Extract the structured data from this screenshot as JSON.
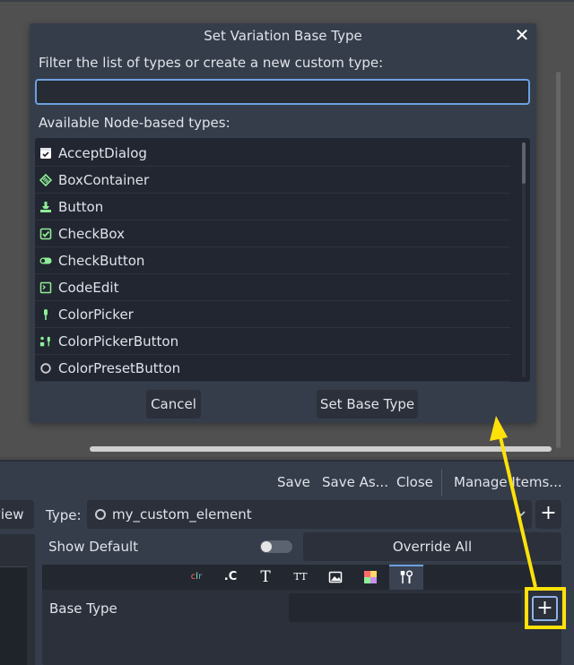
{
  "dialog": {
    "title": "Set Variation Base Type",
    "close_symbol": "✕",
    "filter_label": "Filter the list of types or create a new custom type:",
    "filter_value": "",
    "types_label": "Available Node-based types:",
    "types": [
      {
        "label": "AcceptDialog",
        "icon": "accept-dialog-icon",
        "color": "#ffffff"
      },
      {
        "label": "BoxContainer",
        "icon": "box-container-icon",
        "color": "#8eef97"
      },
      {
        "label": "Button",
        "icon": "button-icon",
        "color": "#8eef97"
      },
      {
        "label": "CheckBox",
        "icon": "checkbox-icon",
        "color": "#8eef97"
      },
      {
        "label": "CheckButton",
        "icon": "check-button-icon",
        "color": "#8eef97"
      },
      {
        "label": "CodeEdit",
        "icon": "code-edit-icon",
        "color": "#8eef97"
      },
      {
        "label": "ColorPicker",
        "icon": "color-picker-icon",
        "color": "#8eef97"
      },
      {
        "label": "ColorPickerButton",
        "icon": "color-picker-button-icon",
        "color": "#8eef97"
      },
      {
        "label": "ColorPresetButton",
        "icon": "color-preset-button-icon",
        "color": "#c9ccd2"
      }
    ],
    "cancel_label": "Cancel",
    "confirm_label": "Set Base Type"
  },
  "toolbar": {
    "save": "Save",
    "save_as": "Save As...",
    "close": "Close",
    "manage_items": "Manage Items..."
  },
  "editor": {
    "view_label": "view",
    "type_label": "Type:",
    "type_value": "my_custom_element",
    "add_symbol": "+",
    "show_default_label": "Show Default",
    "override_all_label": "Override All",
    "tabs": [
      {
        "name": "tab-colors",
        "icon": "colors-icon",
        "text": "clr"
      },
      {
        "name": "tab-constants",
        "icon": "constants-icon",
        "text": ".C"
      },
      {
        "name": "tab-fonts",
        "icon": "font-icon",
        "text": "T"
      },
      {
        "name": "tab-font-sizes",
        "icon": "font-size-icon",
        "text": "TT"
      },
      {
        "name": "tab-icons",
        "icon": "image-icon",
        "text": ""
      },
      {
        "name": "tab-styleboxes",
        "icon": "stylebox-icon",
        "text": ""
      },
      {
        "name": "tab-settings",
        "icon": "tools-icon",
        "text": ""
      }
    ],
    "base_type_label": "Base Type",
    "base_type_value": ""
  },
  "colors": {
    "accent": "#6ca1e0",
    "highlight": "#ffe10a",
    "panel": "#363d4a"
  }
}
